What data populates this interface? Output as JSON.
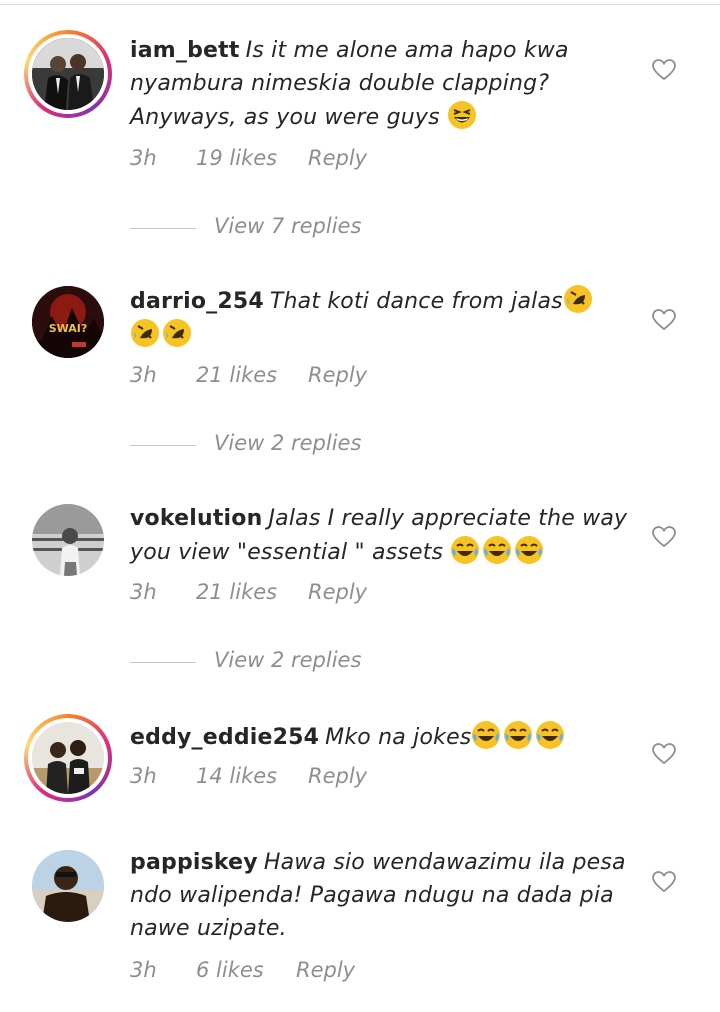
{
  "comments": [
    {
      "username": "iam_bett",
      "text": "Is it me alone ama hapo kwa nyambura nimeskia double clapping? Anyways, as you were guys",
      "emojis": [
        "grinning-squint"
      ],
      "time": "3h",
      "likes": "19 likes",
      "reply": "Reply",
      "view_replies": "View 7 replies",
      "story_ring": true
    },
    {
      "username": "darrio_254",
      "text": "That koti dance from jalas",
      "emojis": [
        "rofl",
        "rofl",
        "rofl"
      ],
      "time": "3h",
      "likes": "21 likes",
      "reply": "Reply",
      "view_replies": "View 2 replies",
      "story_ring": false,
      "avatar_text": "SWAI?"
    },
    {
      "username": "vokelution",
      "text": "Jalas I really appreciate the way you view \"essential \" assets",
      "emojis": [
        "joy",
        "joy",
        "joy"
      ],
      "time": "3h",
      "likes": "21 likes",
      "reply": "Reply",
      "view_replies": "View 2 replies",
      "story_ring": false
    },
    {
      "username": "eddy_eddie254",
      "text": "Mko na jokes",
      "emojis": [
        "joy",
        "joy",
        "joy"
      ],
      "time": "3h",
      "likes": "14 likes",
      "reply": "Reply",
      "story_ring": true
    },
    {
      "username": "pappiskey",
      "text": "Hawa sio wendawazimu ila pesa ndo walipenda! Pagawa ndugu na dada pia nawe uzipate.",
      "emojis": [],
      "time": "3h",
      "likes": "6 likes",
      "reply": "Reply",
      "story_ring": false
    }
  ],
  "colors": {
    "meta": "#8e8e8e",
    "text": "#262626",
    "emoji": "#f7c324"
  }
}
